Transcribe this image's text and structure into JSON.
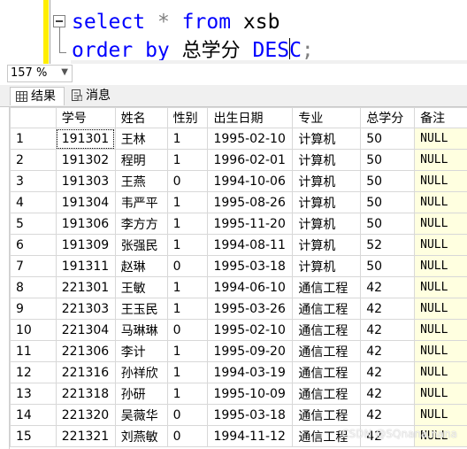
{
  "editor": {
    "line1": {
      "kw1": "select",
      "op": "*",
      "kw2": "from",
      "table": "xsb"
    },
    "line2": {
      "kw1": "order by",
      "col": "总学分",
      "kw2_a": "DES",
      "kw2_b": "C",
      "end": ";"
    }
  },
  "zoom": {
    "value": "157 %"
  },
  "tabs": [
    {
      "label": "结果",
      "icon": "grid-icon"
    },
    {
      "label": "消息",
      "icon": "message-icon"
    }
  ],
  "results": {
    "columns": [
      "学号",
      "姓名",
      "性别",
      "出生日期",
      "专业",
      "总学分",
      "备注"
    ],
    "rows": [
      [
        "1",
        "191301",
        "王林",
        "1",
        "1995-02-10",
        "计算机",
        "50",
        "NULL"
      ],
      [
        "2",
        "191302",
        "程明",
        "1",
        "1996-02-01",
        "计算机",
        "50",
        "NULL"
      ],
      [
        "3",
        "191303",
        "王燕",
        "0",
        "1994-10-06",
        "计算机",
        "50",
        "NULL"
      ],
      [
        "4",
        "191304",
        "韦严平",
        "1",
        "1995-08-26",
        "计算机",
        "50",
        "NULL"
      ],
      [
        "5",
        "191306",
        "李方方",
        "1",
        "1995-11-20",
        "计算机",
        "50",
        "NULL"
      ],
      [
        "6",
        "191309",
        "张强民",
        "1",
        "1994-08-11",
        "计算机",
        "52",
        "NULL"
      ],
      [
        "7",
        "191311",
        "赵琳",
        "0",
        "1995-03-18",
        "计算机",
        "50",
        "NULL"
      ],
      [
        "8",
        "221301",
        "王敏",
        "1",
        "1994-06-10",
        "通信工程",
        "42",
        "NULL"
      ],
      [
        "9",
        "221303",
        "王玉民",
        "1",
        "1995-03-26",
        "通信工程",
        "42",
        "NULL"
      ],
      [
        "10",
        "221304",
        "马琳琳",
        "0",
        "1995-02-10",
        "通信工程",
        "42",
        "NULL"
      ],
      [
        "11",
        "221306",
        "李计",
        "1",
        "1995-09-20",
        "通信工程",
        "42",
        "NULL"
      ],
      [
        "12",
        "221316",
        "孙祥欣",
        "1",
        "1994-03-19",
        "通信工程",
        "42",
        "NULL"
      ],
      [
        "13",
        "221318",
        "孙研",
        "1",
        "1995-10-09",
        "通信工程",
        "42",
        "NULL"
      ],
      [
        "14",
        "221320",
        "吴薇华",
        "0",
        "1995-03-18",
        "通信工程",
        "42",
        "NULL"
      ],
      [
        "15",
        "221321",
        "刘燕敏",
        "0",
        "1994-11-12",
        "通信工程",
        "42",
        "NULL"
      ]
    ]
  },
  "watermark": "CSDN @SQnana.nana"
}
